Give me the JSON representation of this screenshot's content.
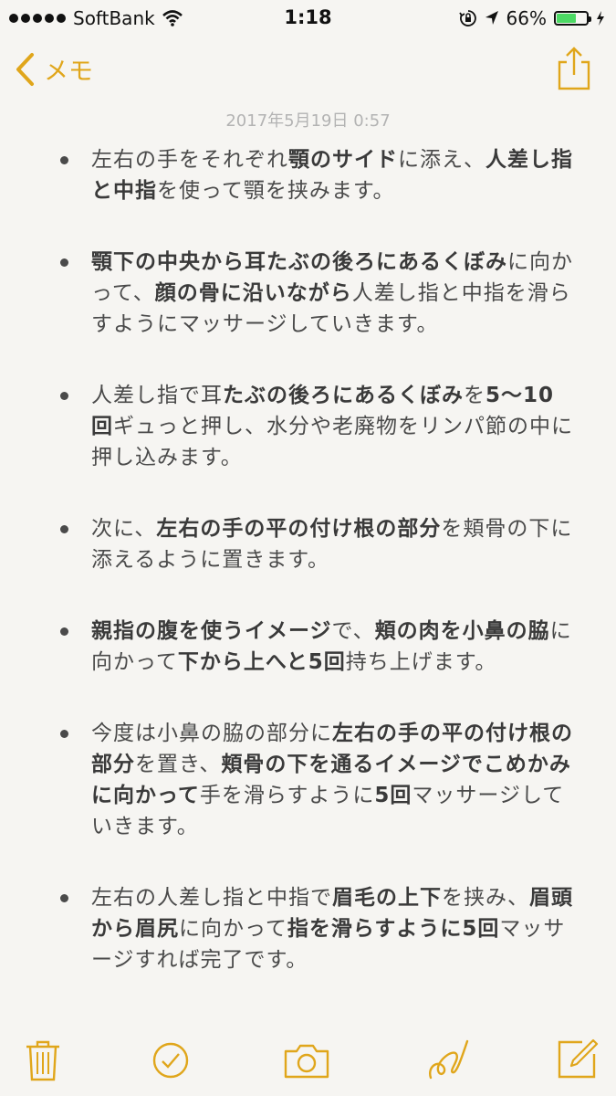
{
  "status_bar": {
    "carrier": "SoftBank",
    "time": "1:18",
    "battery_percent": "66%",
    "battery_level": 0.66,
    "signal_dots": 5
  },
  "nav": {
    "back_label": "メモ",
    "accent_color": "#e0a61b"
  },
  "note": {
    "date": "2017年5月19日 0:57",
    "items": [
      [
        {
          "t": "左右の手をそれぞれ",
          "b": false
        },
        {
          "t": "顎のサイド",
          "b": true
        },
        {
          "t": "に添え、",
          "b": false
        },
        {
          "t": "人差し指と中指",
          "b": true
        },
        {
          "t": "を使って顎を挟みます。",
          "b": false
        }
      ],
      [
        {
          "t": "顎下の中央から耳たぶの後ろにあるくぼみ",
          "b": true
        },
        {
          "t": "に向かって、",
          "b": false
        },
        {
          "t": "顔の骨に沿いながら",
          "b": true
        },
        {
          "t": "人差し指と中指を滑らすようにマッサージしていきます。",
          "b": false
        }
      ],
      [
        {
          "t": "人差し指で耳",
          "b": false
        },
        {
          "t": "たぶの後ろにあるくぼみ",
          "b": true
        },
        {
          "t": "を",
          "b": false
        },
        {
          "t": "5〜10回",
          "b": true
        },
        {
          "t": "ギュっと押し、水分や老廃物をリンパ節の中に押し込みます。",
          "b": false
        }
      ],
      [
        {
          "t": "次に、",
          "b": false
        },
        {
          "t": "左右の手の平の付け根の部分",
          "b": true
        },
        {
          "t": "を頬骨の下に添えるように置きます。",
          "b": false
        }
      ],
      [
        {
          "t": "親指の腹を使うイメージ",
          "b": true
        },
        {
          "t": "で、",
          "b": false
        },
        {
          "t": "頬の肉を小鼻の脇",
          "b": true
        },
        {
          "t": "に向かって",
          "b": false
        },
        {
          "t": "下から上へと5回",
          "b": true
        },
        {
          "t": "持ち上げます。",
          "b": false
        }
      ],
      [
        {
          "t": "今度は小鼻の脇の部分に",
          "b": false
        },
        {
          "t": "左右の手の平の付け根の部分",
          "b": true
        },
        {
          "t": "を置き、",
          "b": false
        },
        {
          "t": "頬骨の下を通るイメージでこめかみに向かって",
          "b": true
        },
        {
          "t": "手を滑らすように",
          "b": false
        },
        {
          "t": "5回",
          "b": true
        },
        {
          "t": "マッサージしていきます。",
          "b": false
        }
      ],
      [
        {
          "t": "左右の人差し指と中指で",
          "b": false
        },
        {
          "t": "眉毛の上下",
          "b": true
        },
        {
          "t": "を挟み、",
          "b": false
        },
        {
          "t": "眉頭から眉尻",
          "b": true
        },
        {
          "t": "に向かって",
          "b": false
        },
        {
          "t": "指を滑らすように5回",
          "b": true
        },
        {
          "t": "マッサージすれば完了です。",
          "b": false
        }
      ]
    ]
  },
  "toolbar": {
    "icons": [
      "trash-icon",
      "checklist-icon",
      "camera-icon",
      "sketch-icon",
      "compose-icon"
    ]
  }
}
